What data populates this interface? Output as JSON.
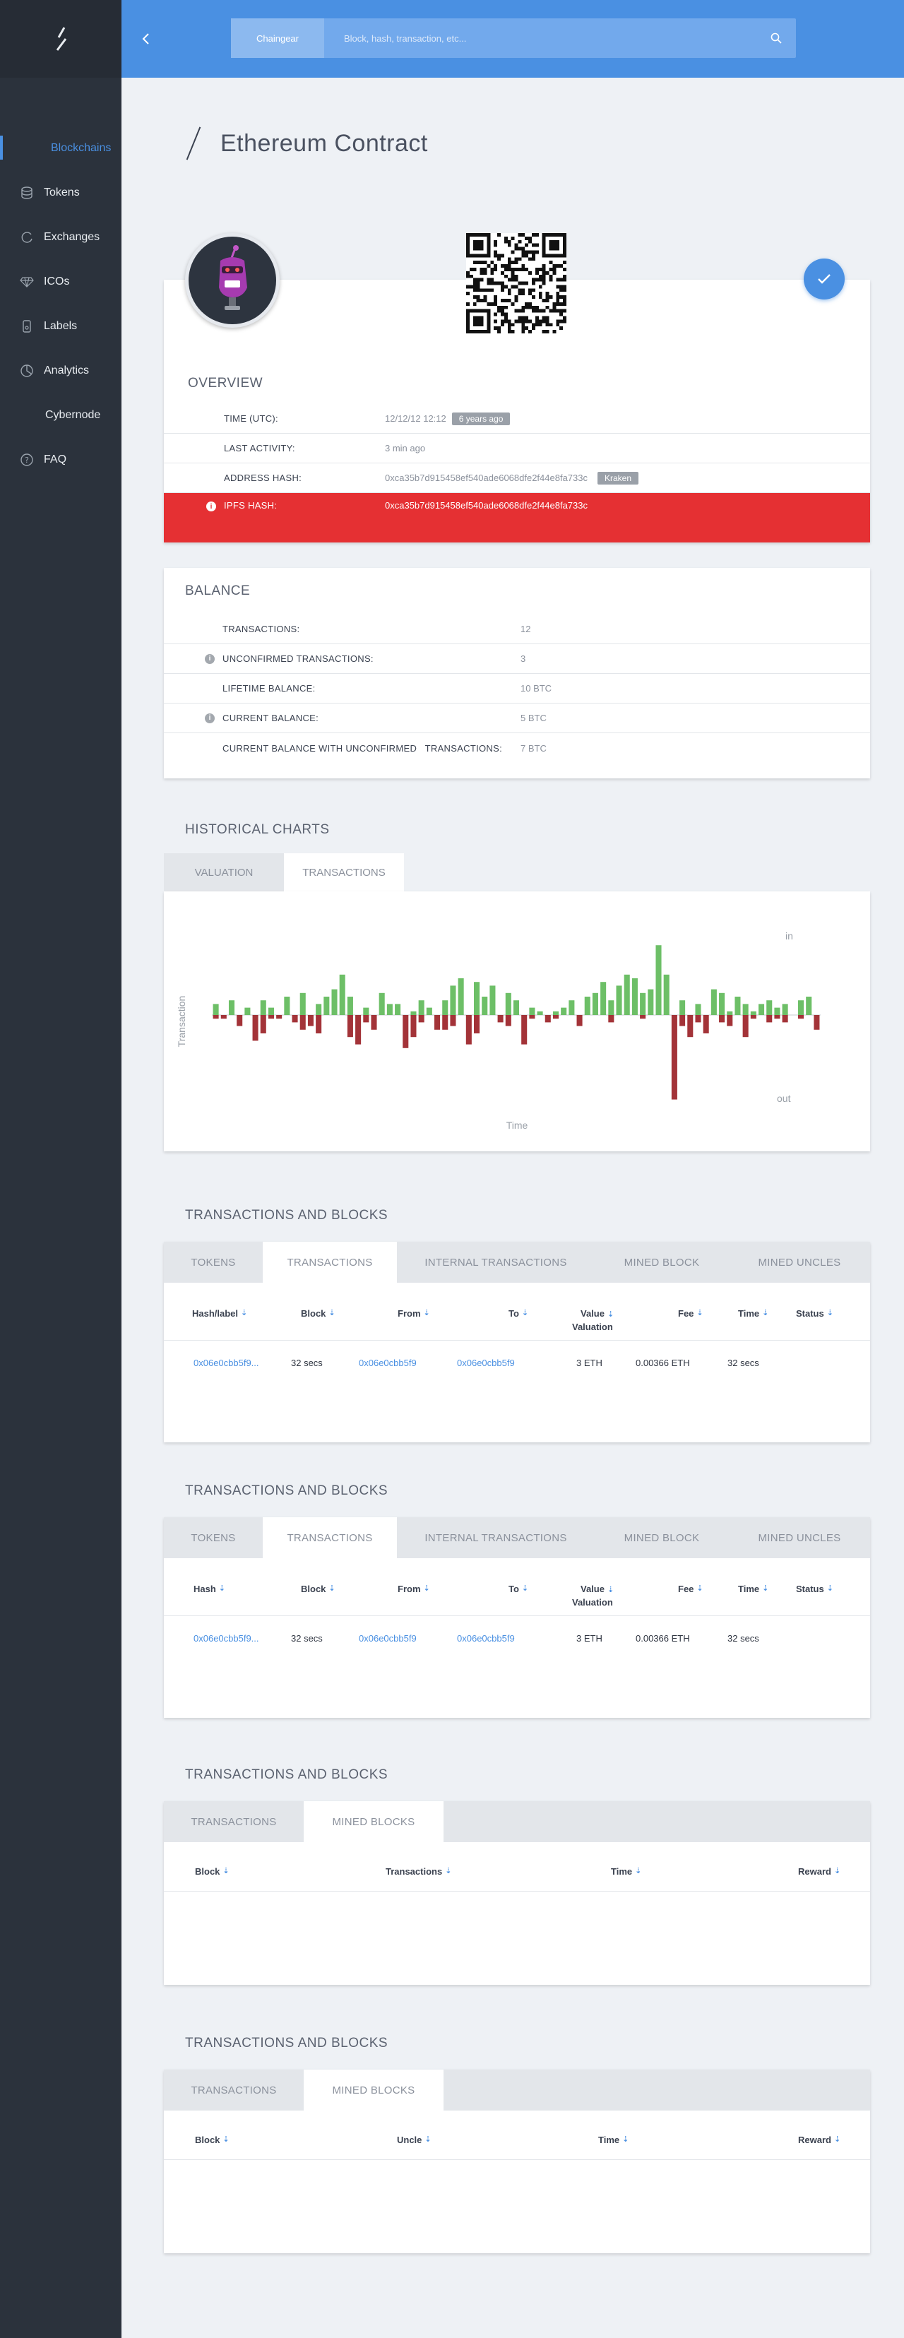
{
  "sidebar": {
    "items": [
      {
        "label": "Blockchains",
        "icon": "blockchains-icon",
        "active": true
      },
      {
        "label": "Tokens",
        "icon": "tokens-icon",
        "active": false
      },
      {
        "label": "Exchanges",
        "icon": "exchanges-icon",
        "active": false
      },
      {
        "label": "ICOs",
        "icon": "diamond-icon",
        "active": false
      },
      {
        "label": "Labels",
        "icon": "labels-icon",
        "active": false
      },
      {
        "label": "Analytics",
        "icon": "analytics-icon",
        "active": false
      },
      {
        "label": "Cybernode",
        "icon": "",
        "active": false
      },
      {
        "label": "FAQ",
        "icon": "question-icon",
        "active": false
      }
    ]
  },
  "header": {
    "search_chip": "Chaingear",
    "search_placeholder": "Block, hash, transaction, etc..."
  },
  "page": {
    "title": "Ethereum Contract"
  },
  "overview": {
    "title": "OVERVIEW",
    "time_key": "TIME (UTC):",
    "time_val": "12/12/12 12:12",
    "time_tag": "6 years ago",
    "last_key": "LAST ACTIVITY:",
    "last_val": "3 min ago",
    "addr_key": "ADDRESS HASH:",
    "addr_val": "0xca35b7d915458ef540ade6068dfe2f44e8fa733c",
    "addr_tag": "Kraken",
    "ipfs_key": "IPFS HASH:",
    "ipfs_val": "0xca35b7d915458ef540ade6068dfe2f44e8fa733c"
  },
  "balance": {
    "title": "BALANCE",
    "rows": [
      {
        "key": "TRANSACTIONS:",
        "val": "12"
      },
      {
        "key": "UNCONFIRMED TRANSACTIONS:",
        "val": "3"
      },
      {
        "key": "LIFETIME BALANCE:",
        "val": "10 BTC"
      },
      {
        "key": "CURRENT BALANCE:",
        "val": "5 BTC"
      },
      {
        "key": "CURRENT BALANCE WITH UNCONFIRMED   TRANSACTIONS:",
        "val": "7 BTC"
      }
    ]
  },
  "charts": {
    "title": "HISTORICAL CHARTS",
    "tabs": [
      "VALUATION",
      "TRANSACTIONS"
    ],
    "ylabel": "Transaction",
    "xlabel": "Time",
    "in_label": "in",
    "out_label": "out"
  },
  "chart_data": {
    "type": "bar",
    "title": "",
    "xlabel": "Time",
    "ylabel": "Transaction",
    "series": [
      {
        "name": "in",
        "color": "#6dbf67",
        "values": [
          3,
          0,
          4,
          0,
          2,
          0,
          4,
          2,
          0,
          5,
          0,
          6,
          0,
          3,
          5,
          7,
          11,
          5,
          0,
          2,
          0,
          6,
          3,
          3,
          0,
          1,
          4,
          2,
          0,
          4,
          8,
          10,
          0,
          9,
          5,
          8,
          0,
          6,
          4,
          0,
          2,
          1,
          0,
          1,
          2,
          4,
          0,
          5,
          6,
          9,
          4,
          8,
          11,
          10,
          6,
          7,
          19,
          11,
          0,
          4,
          0,
          3,
          0,
          7,
          6,
          1,
          5,
          3,
          1,
          3,
          4,
          2,
          3,
          0,
          4,
          5,
          0
        ]
      },
      {
        "name": "out",
        "color": "#a33338",
        "values": [
          1,
          1,
          0,
          3,
          0,
          7,
          5,
          1,
          1,
          0,
          2,
          4,
          3,
          5,
          0,
          0,
          0,
          6,
          8,
          2,
          4,
          0,
          0,
          0,
          9,
          6,
          2,
          0,
          4,
          4,
          3,
          0,
          8,
          5,
          0,
          0,
          2,
          3,
          0,
          8,
          1,
          0,
          2,
          1,
          0,
          0,
          3,
          0,
          0,
          0,
          2,
          0,
          0,
          0,
          1,
          0,
          0,
          0,
          23,
          3,
          6,
          2,
          5,
          0,
          2,
          3,
          0,
          6,
          1,
          0,
          2,
          1,
          2,
          0,
          1,
          0,
          4
        ]
      }
    ],
    "legend_position": "right"
  },
  "tx_tables": [
    {
      "title": "TRANSACTIONS AND BLOCKS",
      "tabs": [
        "TOKENS",
        "TRANSACTIONS",
        "INTERNAL TRANSACTIONS",
        "MINED BLOCK",
        "MINED UNCLES"
      ],
      "active_tab": 1,
      "headers": [
        "Hash/label",
        "Block",
        "From",
        "To",
        "Value",
        "Fee",
        "Time",
        "Status"
      ],
      "sub_header": "Valuation",
      "row": [
        "0x06e0cbb5f9...",
        "32 secs",
        "0x06e0cbb5f9",
        "0x06e0cbb5f9",
        "3 ETH",
        "0.00366 ETH",
        "32 secs",
        ""
      ]
    },
    {
      "title": "TRANSACTIONS AND BLOCKS",
      "tabs": [
        "TOKENS",
        "TRANSACTIONS",
        "INTERNAL TRANSACTIONS",
        "MINED BLOCK",
        "MINED UNCLES"
      ],
      "active_tab": 1,
      "headers": [
        "Hash",
        "Block",
        "From",
        "To",
        "Value",
        "Fee",
        "Time",
        "Status"
      ],
      "sub_header": "Valuation",
      "row": [
        "0x06e0cbb5f9...",
        "32 secs",
        "0x06e0cbb5f9",
        "0x06e0cbb5f9",
        "3 ETH",
        "0.00366 ETH",
        "32 secs",
        ""
      ]
    }
  ],
  "block_tables": [
    {
      "title": "TRANSACTIONS AND BLOCKS",
      "tabs": [
        "TRANSACTIONS",
        "MINED BLOCKS"
      ],
      "headers": [
        "Block",
        "Transactions",
        "Time",
        "Reward"
      ]
    },
    {
      "title": "TRANSACTIONS AND BLOCKS",
      "tabs": [
        "TRANSACTIONS",
        "MINED BLOCKS"
      ],
      "headers": [
        "Block",
        "Uncle",
        "Time",
        "Reward"
      ]
    }
  ]
}
